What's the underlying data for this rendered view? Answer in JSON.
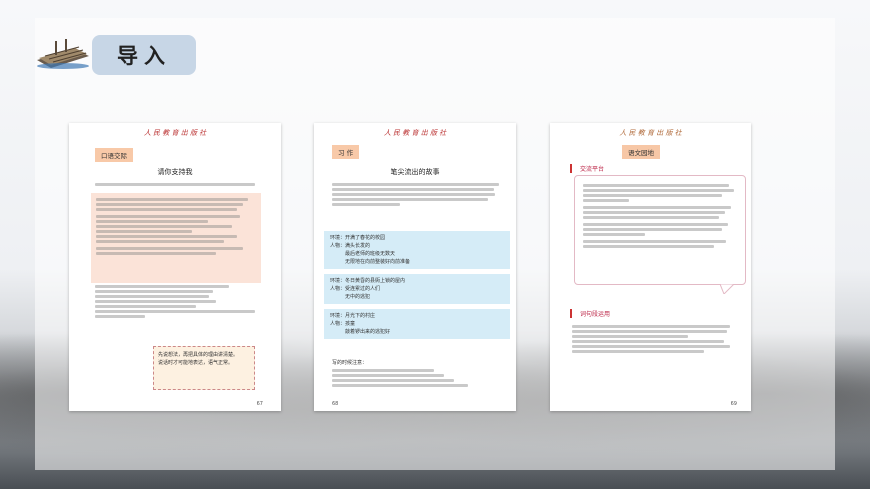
{
  "header": {
    "title": "导入"
  },
  "pages": [
    {
      "tag": "口语交际",
      "heading": "请你支持我",
      "page_number": "67",
      "notes": [
        "先说想法，再把具体的理由讲清楚。",
        "说话时才可能地表达，语气正常。"
      ]
    },
    {
      "tag": "习 作",
      "heading": "笔尖流出的故事",
      "page_number": "68",
      "boxes": [
        {
          "lines": [
            "环境：开满了春花的校园",
            "人物：满头长发的",
            "　　　最后老师的班级无数天",
            "　　　无限地在向前整装好向前准备"
          ]
        },
        {
          "lines": [
            "环境：冬日黄昏的县衙上锁的屋内",
            "人物：受连累过的人们",
            "　　　无中的逃犯"
          ]
        },
        {
          "lines": [
            "环境：月光下的村庄",
            "人物：孩童",
            "　　　敲着锣出来的逃犯好"
          ]
        }
      ],
      "footer_heading": "写的时候注意："
    },
    {
      "tag": "语文园地",
      "section1": "交流平台",
      "section2": "词句段运用",
      "page_number": "69"
    }
  ]
}
